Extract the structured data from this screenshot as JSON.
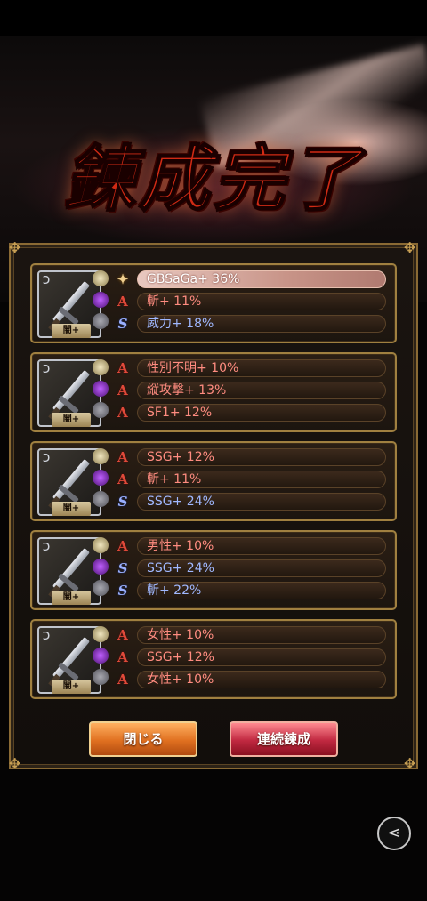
{
  "title": "鍊成完了",
  "weapon_label": "闇+",
  "cards": [
    {
      "skills": [
        {
          "type": "special",
          "text": "GBSaGa+ 36%",
          "highlight": true,
          "color": "white"
        },
        {
          "type": "A",
          "text": "斬+ 11%",
          "color": "red"
        },
        {
          "type": "S",
          "text": "威力+ 18%",
          "color": "blue"
        }
      ]
    },
    {
      "skills": [
        {
          "type": "A",
          "text": "性別不明+ 10%",
          "color": "red"
        },
        {
          "type": "A",
          "text": "縦攻撃+ 13%",
          "color": "red"
        },
        {
          "type": "A",
          "text": "SF1+ 12%",
          "color": "red"
        }
      ]
    },
    {
      "skills": [
        {
          "type": "A",
          "text": "SSG+ 12%",
          "color": "red"
        },
        {
          "type": "A",
          "text": "斬+ 11%",
          "color": "red"
        },
        {
          "type": "S",
          "text": "SSG+ 24%",
          "color": "blue"
        }
      ]
    },
    {
      "skills": [
        {
          "type": "A",
          "text": "男性+ 10%",
          "color": "red"
        },
        {
          "type": "S",
          "text": "SSG+ 24%",
          "color": "blue"
        },
        {
          "type": "S",
          "text": "斬+ 22%",
          "color": "blue"
        }
      ]
    },
    {
      "skills": [
        {
          "type": "A",
          "text": "女性+ 10%",
          "color": "red"
        },
        {
          "type": "A",
          "text": "SSG+ 12%",
          "color": "red"
        },
        {
          "type": "A",
          "text": "女性+ 10%",
          "color": "red"
        }
      ]
    }
  ],
  "buttons": {
    "close": "閉じる",
    "continue": "連続鍊成"
  },
  "icons": {
    "skill_A": "A",
    "skill_S": "S",
    "special": "✦",
    "share": "share-icon"
  },
  "colors": {
    "accent_red": "#d12a14",
    "skill_red": "#ff8c80",
    "skill_blue": "#a0b8ff",
    "frame_gold": "#a08040"
  }
}
